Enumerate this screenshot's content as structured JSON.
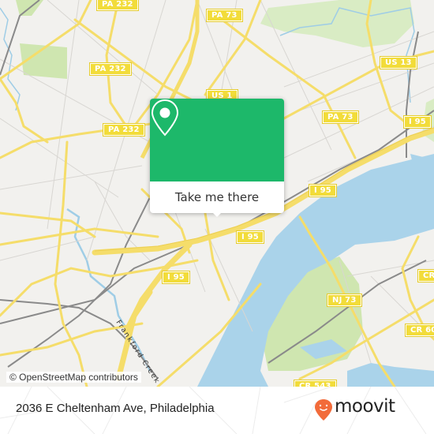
{
  "map": {
    "attribution": "© OpenStreetMap contributors",
    "water_color": "#aad3ea",
    "park_color": "#cfe6b0",
    "road_color": "#f7e27a",
    "background_color": "#f2f1ee",
    "waterway_label": "Frankford Creek",
    "road_shields": [
      {
        "label": "PA 232"
      },
      {
        "label": "PA 232"
      },
      {
        "label": "PA 232"
      },
      {
        "label": "PA 73"
      },
      {
        "label": "US 1"
      },
      {
        "label": "US 13"
      },
      {
        "label": "PA 73"
      },
      {
        "label": "I 95"
      },
      {
        "label": "I 95"
      },
      {
        "label": "I 95"
      },
      {
        "label": "I 95"
      },
      {
        "label": "NJ 73"
      },
      {
        "label": "CR"
      },
      {
        "label": "CR 60"
      },
      {
        "label": "CR 543"
      }
    ]
  },
  "popup": {
    "icon": "map-pin-icon",
    "accent_color": "#1db86a",
    "button_label": "Take me there"
  },
  "footer": {
    "address": "2036 E Cheltenham Ave, Philadelphia",
    "brand": "moovit",
    "brand_color": "#f26b3a"
  }
}
